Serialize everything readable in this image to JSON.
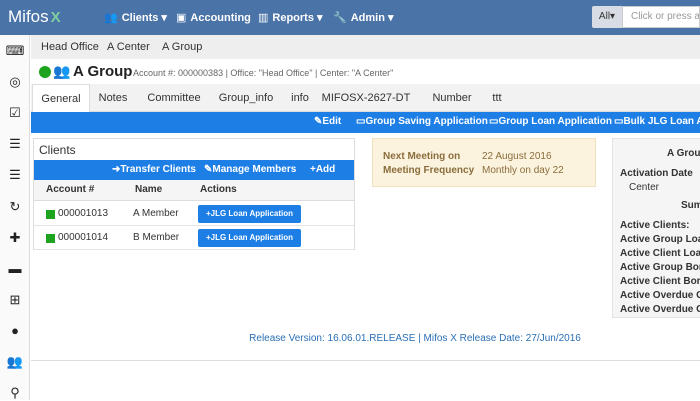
{
  "topnav": {
    "logo": "Mifos",
    "logo_mark": "X",
    "items": [
      {
        "icon": "👥",
        "label": "Clients ▾"
      },
      {
        "icon": "▣",
        "label": "Accounting"
      },
      {
        "icon": "▥",
        "label": "Reports ▾"
      },
      {
        "icon": "🔧",
        "label": "Admin ▾"
      }
    ],
    "search_scope": "All▾",
    "search_placeholder": "Click or press alt+"
  },
  "sidebar": {
    "icons": [
      "⌨",
      "◎",
      "☑",
      "☰",
      "☰",
      "↻",
      "✚",
      "▬",
      "⊞",
      "●",
      "👥",
      "⚲"
    ]
  },
  "breadcrumb": [
    "Head Office",
    "A Center",
    "A Group"
  ],
  "group": {
    "title": "A Group",
    "meta": "Account #: 000000383 | Office: \"Head Office\" | Center: \"A Center\""
  },
  "tabs": [
    "General",
    "Notes",
    "Committee",
    "Group_info",
    "info",
    "MIFOSX-2627-DT",
    "Number",
    "ttt"
  ],
  "actions": [
    "✎Edit",
    "▭Group Saving Application",
    "▭Group Loan Application",
    "▭Bulk JLG Loan Ap"
  ],
  "clients": {
    "heading": "Clients",
    "buttons": [
      "➜Transfer Clients",
      "✎Manage Members",
      "+Add"
    ],
    "columns": [
      "Account #",
      "Name",
      "Actions"
    ],
    "rows": [
      {
        "account": "000001013",
        "name": "A Member",
        "action": "+JLG Loan Application"
      },
      {
        "account": "000001014",
        "name": "B Member",
        "action": "+JLG Loan Application"
      }
    ]
  },
  "meeting": {
    "next_label": "Next Meeting on",
    "next_value": "22 August 2016",
    "freq_label": "Meeting Frequency",
    "freq_value": "Monthly on day 22"
  },
  "summary": {
    "group": "A Group",
    "activation_label": "Activation Date",
    "office": "Center",
    "summary_label": "Sum",
    "rows": [
      "Active Clients:",
      "Active Group Loa",
      "Active Client Loa",
      "Active Group Bor",
      "Active Client Bor",
      "Active Overdue G",
      "Active Overdue C"
    ]
  },
  "release": "Release Version: 16.06.01.RELEASE | Mifos X Release Date: 27/Jun/2016",
  "colors": {
    "nav": "#4a73a8",
    "accent": "#1d7fe6",
    "status": "#1da31d"
  }
}
